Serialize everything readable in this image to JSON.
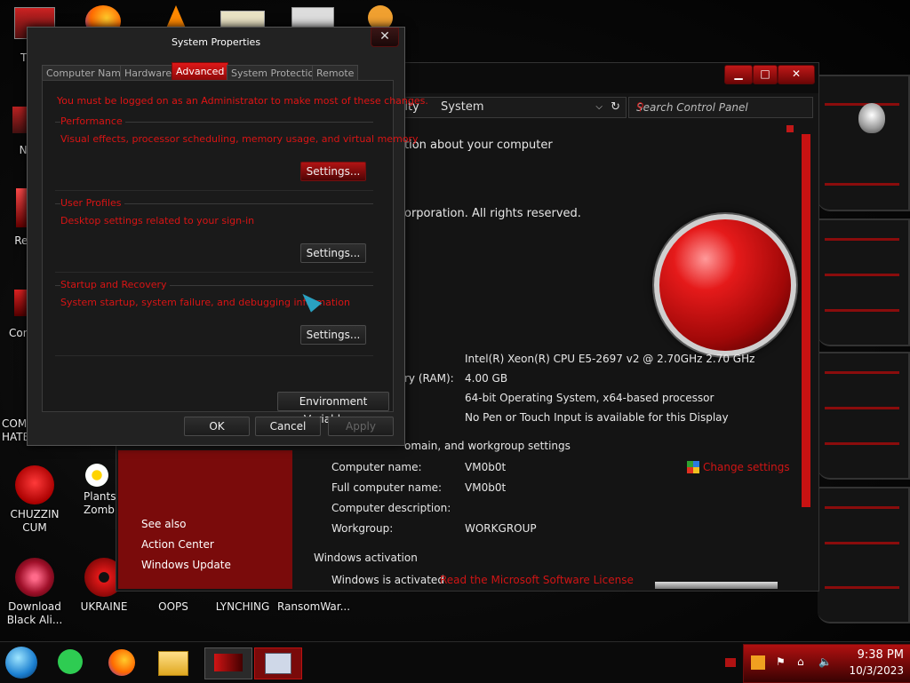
{
  "desktop_icons": [
    {
      "label": "Th",
      "icon": "this-pc-icon"
    },
    {
      "label": "Ne",
      "icon": "network-icon"
    },
    {
      "label": "Rec",
      "icon": "recycle-bin-icon"
    },
    {
      "label": "Cont",
      "icon": "control-panel-icon"
    },
    {
      "label": "COMI HATE",
      "icon": "app-icon"
    },
    {
      "label": "CHUZZIN CUM",
      "icon": "chuzzle-icon"
    },
    {
      "label": "Plants Zomb",
      "icon": "plants-vs-zombies-icon"
    },
    {
      "label": "Download Black Ali...",
      "icon": "download-icon"
    },
    {
      "label": "UKRAINE",
      "icon": "radiation-icon"
    },
    {
      "label": "OOPS",
      "icon": "blank-icon"
    },
    {
      "label": "LYNCHING",
      "icon": "blank-icon"
    },
    {
      "label": "RansomWar...",
      "icon": "blank-icon"
    }
  ],
  "control_panel": {
    "breadcrumb_fragment": "rity",
    "breadcrumb_current": "System",
    "search_placeholder": "Search Control Panel",
    "heading_fragment": "tion about your computer",
    "copyright_fragment": "orporation. All rights reserved.",
    "processor_value": "Intel(R) Xeon(R) CPU E5-2697 v2 @ 2.70GHz   2.70 GHz",
    "ram_label_fragment": "ry (RAM):",
    "ram_value": "4.00 GB",
    "system_type_value": "64-bit Operating System, x64-based processor",
    "pen_touch_value": "No Pen or Touch Input is available for this Display",
    "computer_section_fragment": "omain, and workgroup settings",
    "computer_name_label": "Computer name:",
    "computer_name_value": "VM0b0t",
    "full_name_label": "Full computer name:",
    "full_name_value": "VM0b0t",
    "description_label": "Computer description:",
    "workgroup_label": "Workgroup:",
    "workgroup_value": "WORKGROUP",
    "change_settings": "Change settings",
    "activation_heading": "Windows activation",
    "activation_status": "Windows is activated",
    "license_link": "Read the Microsoft Software License",
    "see_also": "See also",
    "action_center": "Action Center",
    "windows_update": "Windows Update"
  },
  "dialog": {
    "title": "System Properties",
    "tabs": [
      "Computer Name",
      "Hardware",
      "Advanced",
      "System Protection",
      "Remote"
    ],
    "active_tab": "Advanced",
    "admin_warning": "You must be logged on as an Administrator to make most of these changes.",
    "performance_title": "Performance",
    "performance_desc": "Visual effects, processor scheduling, memory usage, and virtual memory",
    "user_profiles_title": "User Profiles",
    "user_profiles_desc": "Desktop settings related to your sign-in",
    "startup_title": "Startup and Recovery",
    "startup_desc": "System startup, system failure, and debugging information",
    "settings_label": "Settings...",
    "env_vars_label": "Environment Variables...",
    "ok_label": "OK",
    "cancel_label": "Cancel",
    "apply_label": "Apply"
  },
  "taskbar": {
    "time": "9:38 PM",
    "date": "10/3/2023",
    "apps": [
      "start-orb-icon",
      "notes-icon",
      "firefox-icon",
      "file-explorer-icon",
      "theme-app-icon",
      "system-monitor-icon"
    ]
  },
  "colors": {
    "accent": "#d01414",
    "dark_bg": "#141414",
    "panel_red": "#7a0b0b"
  }
}
